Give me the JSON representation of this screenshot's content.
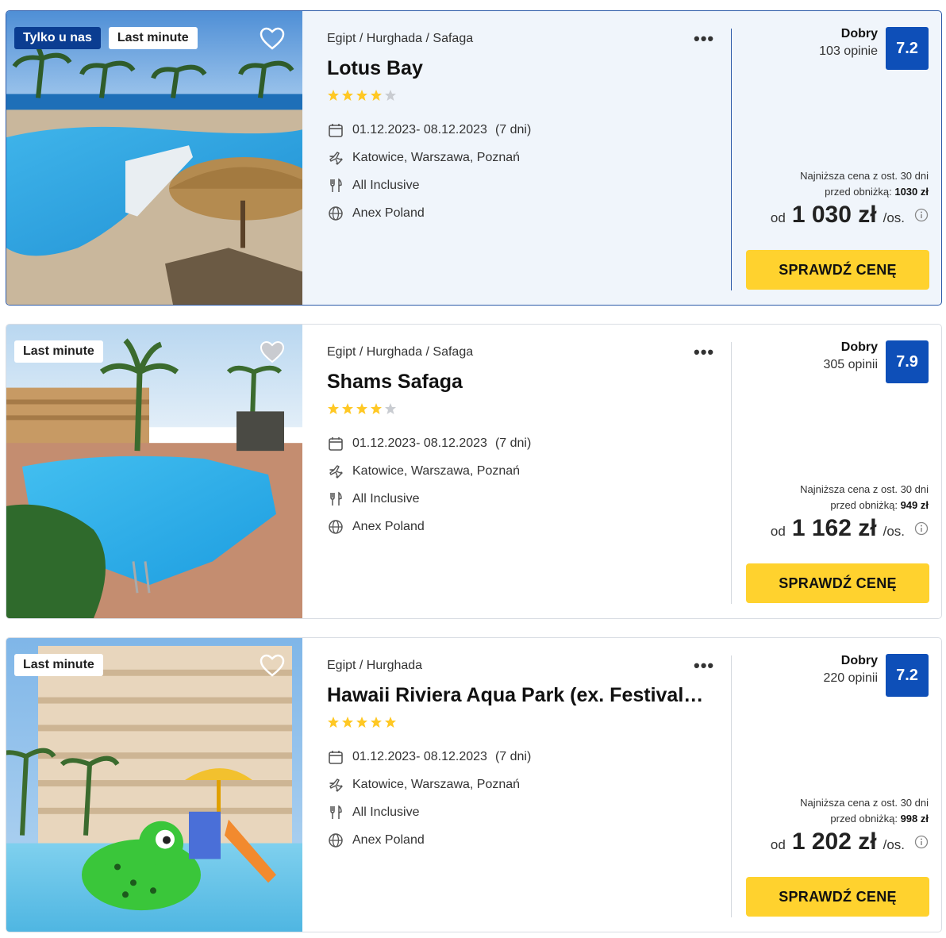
{
  "offers": [
    {
      "badges": [
        "Tylko u nas",
        "Last minute"
      ],
      "location": "Egipt / Hurghada / Safaga",
      "name": "Lotus Bay",
      "stars": 4,
      "dates": "01.12.2023- 08.12.2023",
      "duration": "(7 dni)",
      "departure": "Katowice, Warszawa, Poznań",
      "board": "All Inclusive",
      "operator": "Anex Poland",
      "rating_word": "Dobry",
      "reviews": "103 opinie",
      "score": "7.2",
      "lowest_line1": "Najniższa cena z ost. 30 dni",
      "lowest_line2_prefix": "przed obniżką:",
      "lowest_value": "1030 zł",
      "price_prefix": "od",
      "price": "1 030 zł",
      "price_suffix": "/os.",
      "cta": "SPRAWDŹ CENĘ",
      "favorite": true
    },
    {
      "badges": [
        "Last minute"
      ],
      "location": "Egipt / Hurghada / Safaga",
      "name": "Shams Safaga",
      "stars": 4,
      "dates": "01.12.2023- 08.12.2023",
      "duration": "(7 dni)",
      "departure": "Katowice, Warszawa, Poznań",
      "board": "All Inclusive",
      "operator": "Anex Poland",
      "rating_word": "Dobry",
      "reviews": "305 opinii",
      "score": "7.9",
      "lowest_line1": "Najniższa cena z ost. 30 dni",
      "lowest_line2_prefix": "przed obniżką:",
      "lowest_value": "949 zł",
      "price_prefix": "od",
      "price": "1 162 zł",
      "price_suffix": "/os.",
      "cta": "SPRAWDŹ CENĘ",
      "favorite": false
    },
    {
      "badges": [
        "Last minute"
      ],
      "location": "Egipt / Hurghada",
      "name": "Hawaii Riviera Aqua Park (ex. Festival Riviera)",
      "stars": 5,
      "dates": "01.12.2023- 08.12.2023",
      "duration": "(7 dni)",
      "departure": "Katowice, Warszawa, Poznań",
      "board": "All Inclusive",
      "operator": "Anex Poland",
      "rating_word": "Dobry",
      "reviews": "220 opinii",
      "score": "7.2",
      "lowest_line1": "Najniższa cena z ost. 30 dni",
      "lowest_line2_prefix": "przed obniżką:",
      "lowest_value": "998 zł",
      "price_prefix": "od",
      "price": "1 202 zł",
      "price_suffix": "/os.",
      "cta": "SPRAWDŹ CENĘ",
      "favorite": true
    }
  ],
  "colors": {
    "accent_blue": "#0e4fb8",
    "badge_dark": "#0b3d91",
    "cta_yellow": "#ffd22e",
    "star_yellow": "#ffc824",
    "star_gray": "#c9ccd1",
    "highlight_bg": "#f0f5fb"
  }
}
